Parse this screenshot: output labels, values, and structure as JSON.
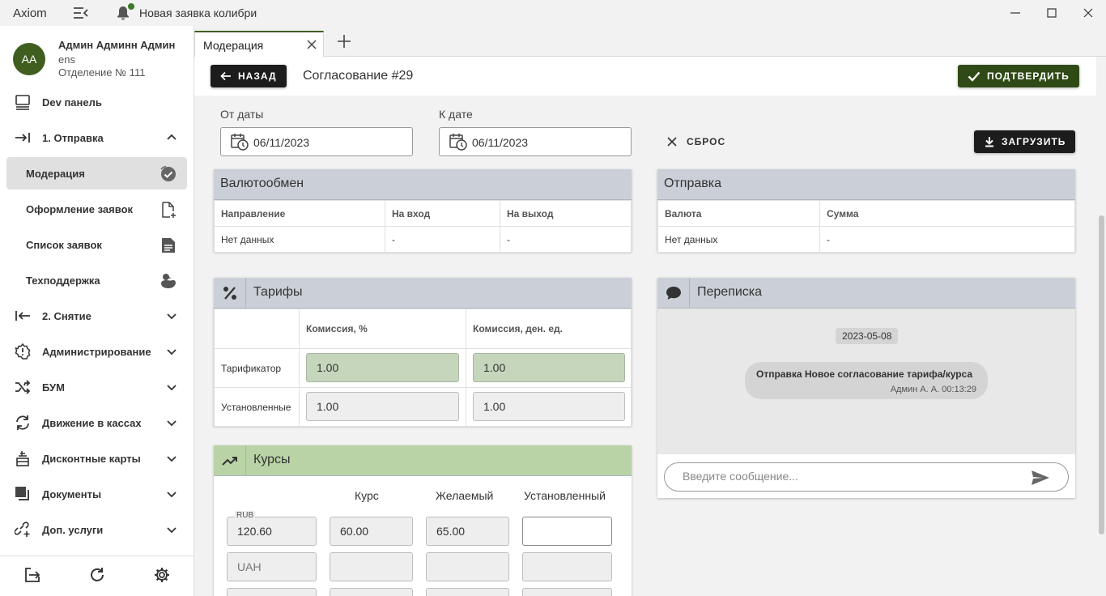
{
  "titlebar": {
    "app_name": "Axiom",
    "notification": "Новая заявка колибри"
  },
  "user": {
    "initials": "АА",
    "name": "Админ Админн Админ",
    "login": "ens",
    "department": "Отделение № 111"
  },
  "sidebar": {
    "items": [
      {
        "label": "Dev панель",
        "icon": "monitor-icon"
      },
      {
        "label": "1. Отправка",
        "icon": "send-arrow-icon",
        "expanded": true
      },
      {
        "label": "Модерация",
        "icon": "check-circle-icon",
        "active": true
      },
      {
        "label": "Оформление заявок",
        "icon": "file-add-icon"
      },
      {
        "label": "Список заявок",
        "icon": "document-list-icon"
      },
      {
        "label": "Техподдержка",
        "icon": "duck-icon"
      },
      {
        "label": "2. Снятие",
        "icon": "receive-arrow-icon"
      },
      {
        "label": "Администрирование",
        "icon": "admin-gear-icon"
      },
      {
        "label": "БУМ",
        "icon": "shuffle-icon"
      },
      {
        "label": "Движение в кассах",
        "icon": "sync-icon"
      },
      {
        "label": "Дисконтные карты",
        "icon": "card-stack-icon"
      },
      {
        "label": "Документы",
        "icon": "documents-icon"
      },
      {
        "label": "Доп. услуги",
        "icon": "link-plus-icon"
      }
    ]
  },
  "tabs": [
    {
      "label": "Модерация"
    }
  ],
  "header": {
    "back_label": "НАЗАД",
    "title": "Согласование #29",
    "confirm_label": "ПОДТВЕРДИТЬ"
  },
  "filters": {
    "from_label": "От даты",
    "from_value": "06/11/2023",
    "to_label": "К дате",
    "to_value": "06/11/2023",
    "reset_label": "СБРОС",
    "load_label": "ЗАГРУЗИТЬ"
  },
  "exchange": {
    "title": "Валютообмен",
    "columns": [
      "Направление",
      "На вход",
      "На выход"
    ],
    "rows": [
      [
        "Нет данных",
        "-",
        "-"
      ]
    ]
  },
  "sending": {
    "title": "Отправка",
    "columns": [
      "Валюта",
      "Сумма"
    ],
    "rows": [
      [
        "Нет данных",
        "-"
      ]
    ]
  },
  "tariffs": {
    "title": "Тарифы",
    "columns": [
      "Комиссия, %",
      "Комиссия, ден. ед."
    ],
    "rows": [
      {
        "label": "Тарификатор",
        "values": [
          "1.00",
          "1.00"
        ]
      },
      {
        "label": "Установленные",
        "values": [
          "1.00",
          "1.00"
        ]
      }
    ]
  },
  "rates": {
    "title": "Курсы",
    "columns": [
      "Курс",
      "Желаемый",
      "Установленный"
    ],
    "rows": [
      {
        "currency": "RUB",
        "value": "120.60",
        "rate": "60.00",
        "desired": "65.00",
        "set": ""
      },
      {
        "currency": "UAH",
        "value": "",
        "rate": "",
        "desired": "",
        "set": ""
      }
    ]
  },
  "chat": {
    "title": "Переписка",
    "date": "2023-05-08",
    "message": "Отправка Новое согласование тарифа/курса",
    "author_time": "Админ А. А. 00:13:29",
    "placeholder": "Введите сообщение..."
  },
  "colors": {
    "accent_green": "#2f4a16",
    "avatar": "#3f5e1f",
    "card_header": "#cbd0d8",
    "rates_header": "#b9d3a6",
    "tariff_highlight": "#c5d6bd"
  }
}
